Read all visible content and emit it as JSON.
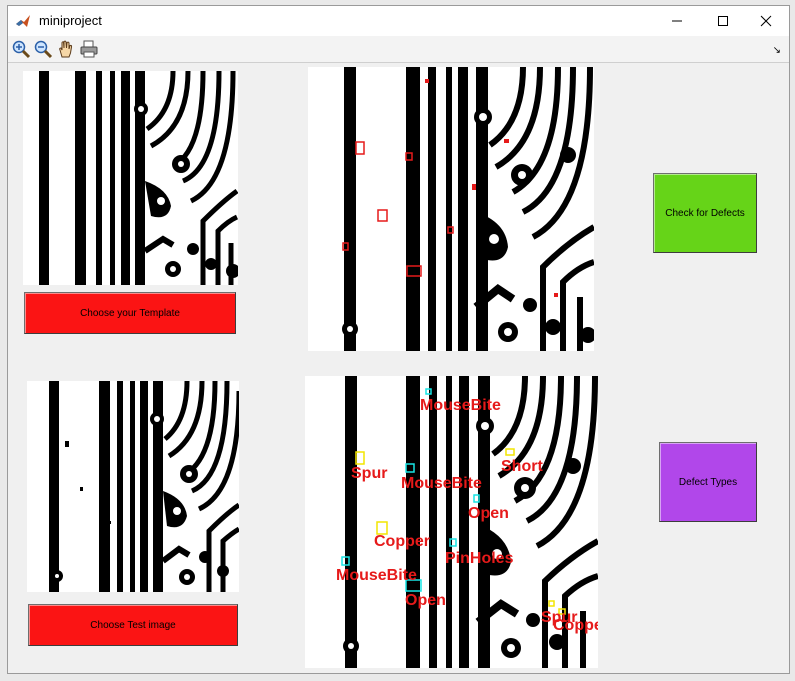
{
  "window": {
    "title": "miniproject",
    "controls": [
      "minimize-icon",
      "maximize-icon",
      "close-icon"
    ]
  },
  "toolbar": {
    "tools": [
      "zoom-in-icon",
      "zoom-out-icon",
      "pan-hand-icon",
      "print-icon"
    ],
    "dock_glyph": "↘"
  },
  "buttons": {
    "choose_template": {
      "label": "Choose your Template",
      "color": "#fb1414"
    },
    "choose_test": {
      "label": "Choose Test image",
      "color": "#fb1414"
    },
    "check_defects": {
      "label": "Check for Defects",
      "color": "#66d418"
    },
    "defect_types": {
      "label": "Defect Types",
      "color": "#b147ea"
    }
  },
  "defect_labels": [
    {
      "id": "mousebite-1",
      "text": "MouseBite"
    },
    {
      "id": "spur-1",
      "text": "Spur"
    },
    {
      "id": "short-1",
      "text": "Short"
    },
    {
      "id": "mousebite-2",
      "text": "MouseBite"
    },
    {
      "id": "open-1",
      "text": "Open"
    },
    {
      "id": "copper-1",
      "text": "Copper"
    },
    {
      "id": "pinholes-1",
      "text": "PinHoles"
    },
    {
      "id": "mousebite-3",
      "text": "MouseBite"
    },
    {
      "id": "open-2",
      "text": "Open"
    },
    {
      "id": "spur-2",
      "text": "Spur"
    },
    {
      "id": "copper-2",
      "text": "Copper"
    }
  ],
  "colors": {
    "defect_box_red": "#e61a1a",
    "defect_box_yellow": "#f2e600",
    "defect_box_cyan": "#19e6e6",
    "label_red": "#e61a1a"
  }
}
